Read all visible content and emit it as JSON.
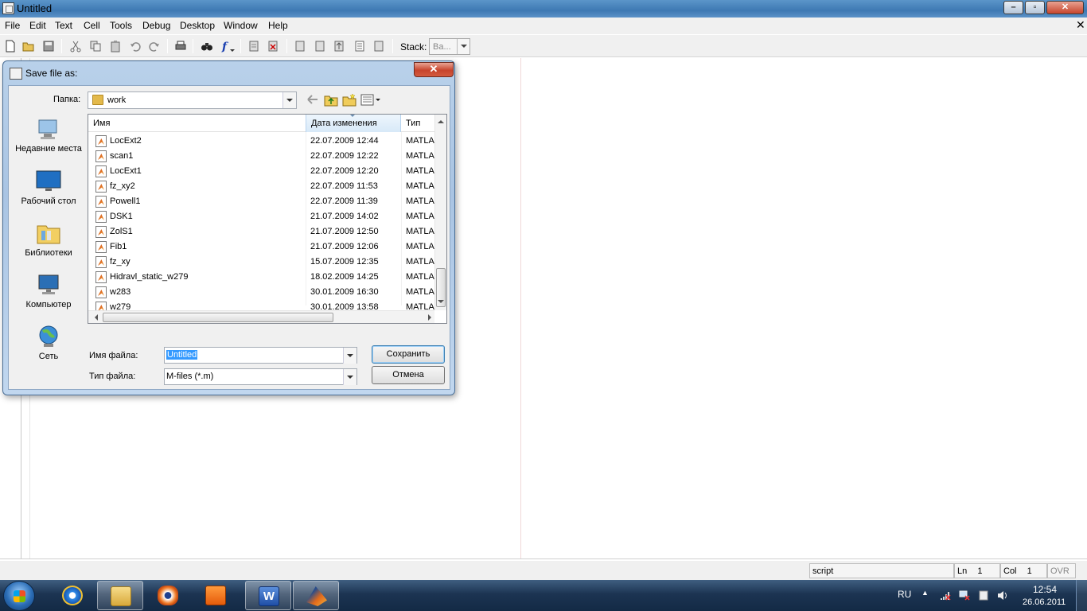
{
  "window": {
    "title": "Untitled"
  },
  "menu": [
    "File",
    "Edit",
    "Text",
    "Cell",
    "Tools",
    "Debug",
    "Desktop",
    "Window",
    "Help"
  ],
  "toolbar": {
    "stack_label": "Stack:",
    "stack_value": "Ba..."
  },
  "status": {
    "mode": "script",
    "ln_label": "Ln",
    "ln_value": "1",
    "col_label": "Col",
    "col_value": "1",
    "ovr": "OVR"
  },
  "dialog": {
    "title": "Save file as:",
    "folder_label": "Папка:",
    "folder_value": "work",
    "places": [
      "Недавние места",
      "Рабочий стол",
      "Библиотеки",
      "Компьютер",
      "Сеть"
    ],
    "columns": {
      "name": "Имя",
      "date": "Дата изменения",
      "type": "Тип"
    },
    "files": [
      {
        "name": "LocExt2",
        "date": "22.07.2009 12:44",
        "type": "MATLA"
      },
      {
        "name": "scan1",
        "date": "22.07.2009 12:22",
        "type": "MATLA"
      },
      {
        "name": "LocExt1",
        "date": "22.07.2009 12:20",
        "type": "MATLA"
      },
      {
        "name": "fz_xy2",
        "date": "22.07.2009 11:53",
        "type": "MATLA"
      },
      {
        "name": "Powell1",
        "date": "22.07.2009 11:39",
        "type": "MATLA"
      },
      {
        "name": "DSK1",
        "date": "21.07.2009 14:02",
        "type": "MATLA"
      },
      {
        "name": "ZolS1",
        "date": "21.07.2009 12:50",
        "type": "MATLA"
      },
      {
        "name": "Fib1",
        "date": "21.07.2009 12:06",
        "type": "MATLA"
      },
      {
        "name": "fz_xy",
        "date": "15.07.2009 12:35",
        "type": "MATLA"
      },
      {
        "name": "Hidravl_static_w279",
        "date": "18.02.2009 14:25",
        "type": "MATLA"
      },
      {
        "name": "w283",
        "date": "30.01.2009 16:30",
        "type": "MATLA"
      },
      {
        "name": "w279",
        "date": "30.01.2009 13:58",
        "type": "MATLA"
      }
    ],
    "filename_label": "Имя файла:",
    "filename_value": "Untitled",
    "filetype_label": "Тип файла:",
    "filetype_value": "M-files (*.m)",
    "save_button": "Сохранить",
    "cancel_button": "Отмена"
  },
  "taskbar": {
    "language": "RU",
    "time": "12:54",
    "date": "26.06.2011"
  }
}
